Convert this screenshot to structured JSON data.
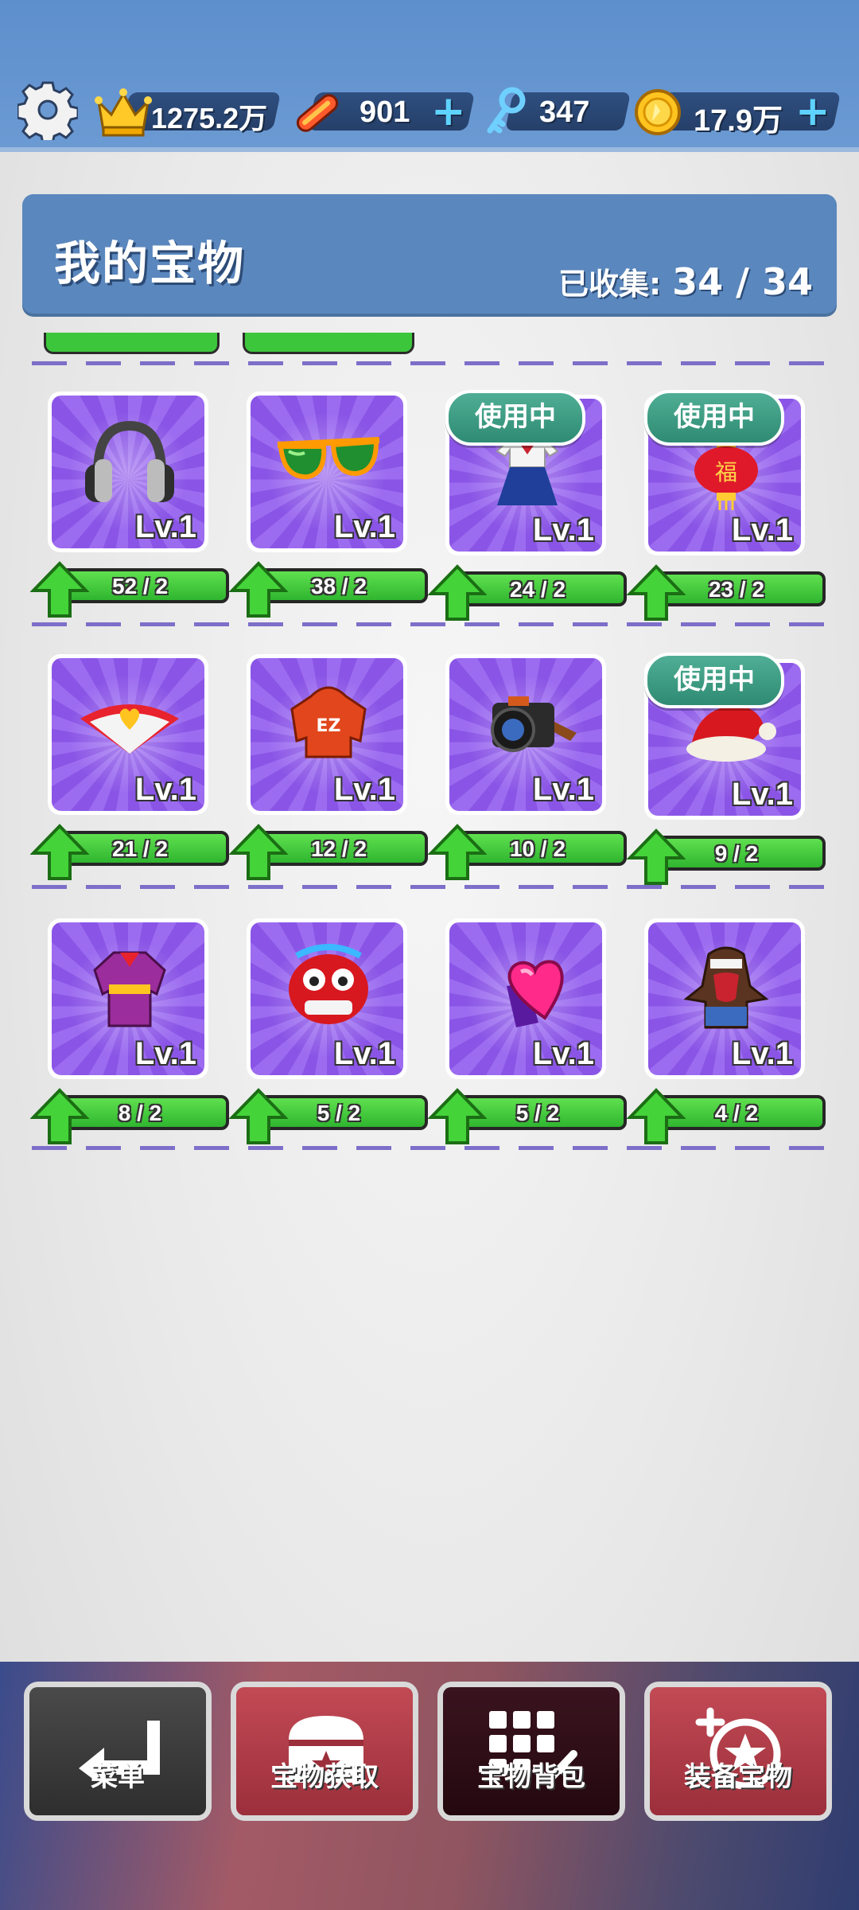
{
  "topbar": {
    "crown_value": "1275.2万",
    "board_value": "901",
    "key_value": "347",
    "coin_value": "17.9万",
    "plus": "+"
  },
  "header": {
    "title": "我的宝物",
    "collected_label": "已收集:",
    "collected_count": "34 / 34"
  },
  "items": [
    {
      "name": "headphones",
      "level": "Lv.1",
      "progress": "52 / 2",
      "in_use": false
    },
    {
      "name": "sunglasses",
      "level": "Lv.1",
      "progress": "38 / 2",
      "in_use": false
    },
    {
      "name": "school-uniform",
      "level": "Lv.1",
      "progress": "24 / 2",
      "in_use": true
    },
    {
      "name": "red-lantern",
      "level": "Lv.1",
      "progress": "23 / 2",
      "in_use": true
    },
    {
      "name": "heart-fan",
      "level": "Lv.1",
      "progress": "21 / 2",
      "in_use": false
    },
    {
      "name": "ez-hoodie",
      "level": "Lv.1",
      "progress": "12 / 2",
      "in_use": false
    },
    {
      "name": "camera",
      "level": "Lv.1",
      "progress": "10 / 2",
      "in_use": false
    },
    {
      "name": "santa-hat",
      "level": "Lv.1",
      "progress": "9 / 2",
      "in_use": true
    },
    {
      "name": "purple-robe",
      "level": "Lv.1",
      "progress": "8 / 2",
      "in_use": false
    },
    {
      "name": "lion-dance-head",
      "level": "Lv.1",
      "progress": "5 / 2",
      "in_use": false
    },
    {
      "name": "heart-gem-ring",
      "level": "Lv.1",
      "progress": "5 / 2",
      "in_use": false
    },
    {
      "name": "bird-costume",
      "level": "Lv.1",
      "progress": "4 / 2",
      "in_use": false
    }
  ],
  "in_use_label": "使用中",
  "bottomnav": {
    "menu": "菜单",
    "get_treasure": "宝物获取",
    "treasure_bag": "宝物背包",
    "equip_treasure": "装备宝物"
  }
}
